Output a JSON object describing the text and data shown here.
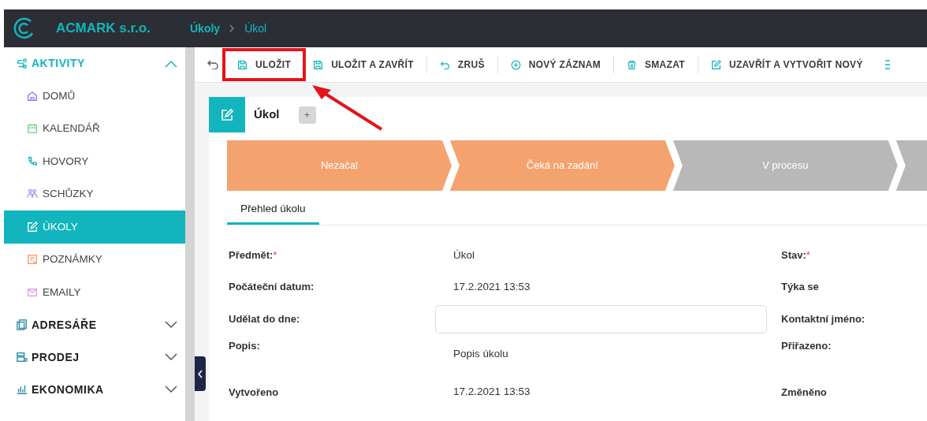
{
  "header": {
    "company": "ACMARK s.r.o.",
    "breadcrumb": [
      "Úkoly",
      "Úkol"
    ]
  },
  "sidebar": [
    {
      "label": "AKTIVITY",
      "expanded": true,
      "children": [
        {
          "label": "DOMŮ",
          "selected": false
        },
        {
          "label": "KALENDÁŘ",
          "selected": false
        },
        {
          "label": "HOVORY",
          "selected": false
        },
        {
          "label": "SCHŮZKY",
          "selected": false
        },
        {
          "label": "ÚKOLY",
          "selected": true
        },
        {
          "label": "POZNÁMKY",
          "selected": false
        },
        {
          "label": "EMAILY",
          "selected": false
        }
      ]
    },
    {
      "label": "ADRESÁŘE",
      "expanded": false
    },
    {
      "label": "PRODEJ",
      "expanded": false
    },
    {
      "label": "EKONOMIKA",
      "expanded": false
    }
  ],
  "toolbar": [
    {
      "kind": "save",
      "label": "ULOŽIT",
      "highlighted": true
    },
    {
      "kind": "save-close",
      "label": "ULOŽIT A ZAVŘÍT",
      "highlighted": false
    },
    {
      "kind": "cancel",
      "label": "ZRUŠ",
      "highlighted": false
    },
    {
      "kind": "new",
      "label": "NOVÝ ZÁZNAM",
      "highlighted": false
    },
    {
      "kind": "delete",
      "label": "SMAZAT",
      "highlighted": false
    },
    {
      "kind": "close-new",
      "label": "UZAVŘÍT A VYTVOŘIT NOVÝ",
      "highlighted": false
    }
  ],
  "record": {
    "title": "Úkol",
    "add_button": "+"
  },
  "stages": [
    {
      "label": "Nezačal",
      "done": true
    },
    {
      "label": "Čeká na zadání",
      "done": true
    },
    {
      "label": "V procesu",
      "done": false
    }
  ],
  "tabs": [
    {
      "label": "Přehled úkolu",
      "selected": true
    }
  ],
  "fields": [
    {
      "label": "Předmět:",
      "required_mark": "*",
      "kind": "text",
      "value": "Úkol",
      "right_label": "Stav:",
      "right_required_mark": "*"
    },
    {
      "label": "Počáteční datum:",
      "kind": "text",
      "value": "17.2.2021 13:53",
      "right_label": "Týka se"
    },
    {
      "label": "Udělat do dne:",
      "kind": "input",
      "right_label": "Kontaktní jméno:"
    },
    {
      "label": "Popis:",
      "kind": "multiline",
      "value": "Popis úkolu",
      "right_label": "Přiřazeno:"
    },
    {
      "label": "Vytvořeno",
      "kind": "text",
      "value": "17.2.2021 13:53",
      "right_label": "Změněno"
    }
  ]
}
